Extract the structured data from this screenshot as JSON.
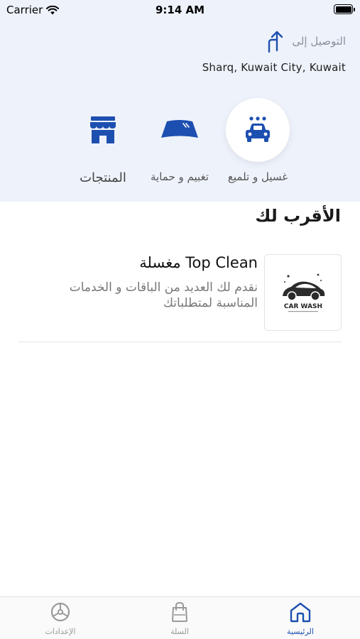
{
  "status_bar": {
    "carrier": "Carrier",
    "time": "9:14 AM"
  },
  "delivery": {
    "label": "التوصيل إلى",
    "address": "Sharq, Kuwait City, Kuwait"
  },
  "categories": [
    {
      "label": "غسيل و تلميع",
      "icon": "car-wash-icon"
    },
    {
      "label": "تغبيم و حماية",
      "icon": "windshield-icon"
    },
    {
      "label": "المنتجات",
      "icon": "store-icon"
    }
  ],
  "nearest": {
    "title": "الأقرب لك",
    "store": {
      "name": "مغسلة Top Clean",
      "description": "نقدم لك العديد من الباقات و الخدمات المناسبة لمتطلباتك",
      "logo_text": "CAR WASH"
    }
  },
  "tab_bar": {
    "home": "الرئيسية",
    "cart": "السلة",
    "settings": "الإعدادات"
  },
  "colors": {
    "accent": "#1d4fb0",
    "header_bg": "#eef2fb"
  }
}
